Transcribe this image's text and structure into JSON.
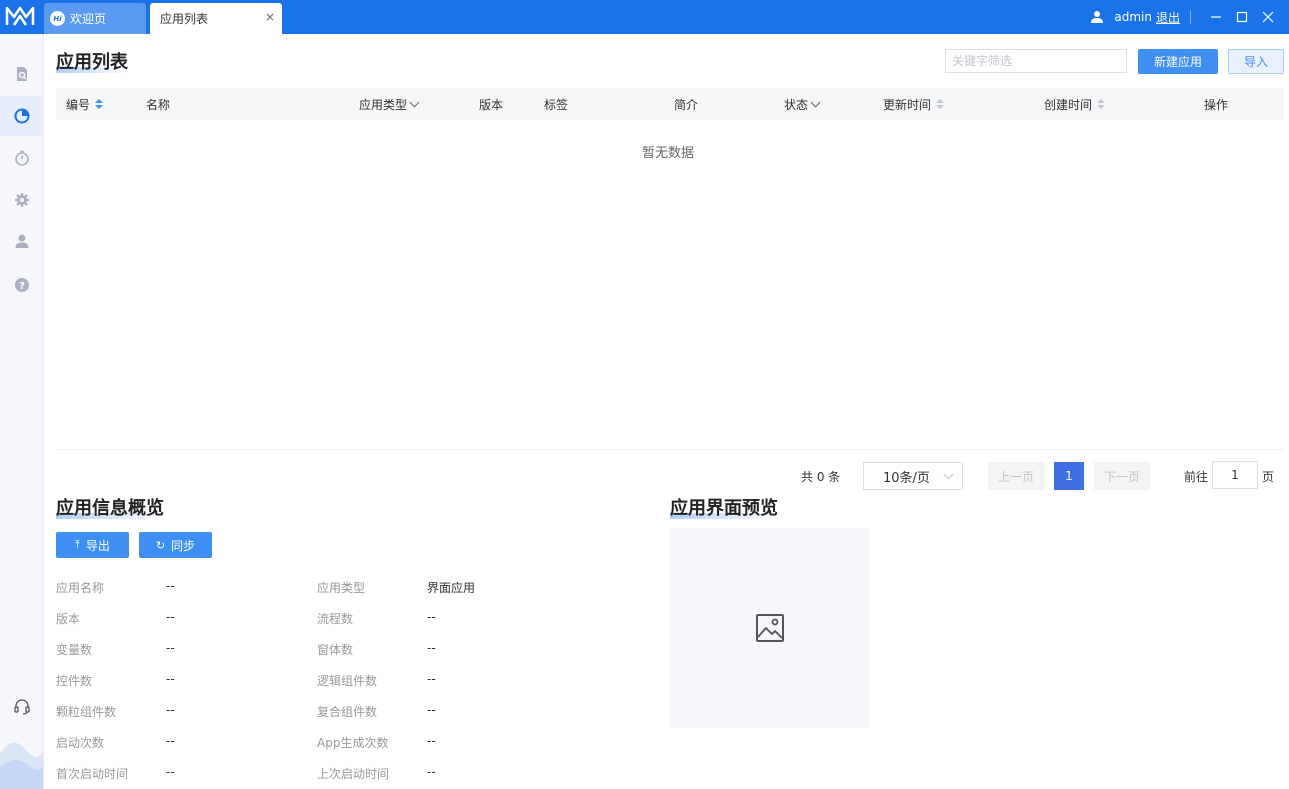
{
  "tabs": [
    {
      "label": "欢迎页",
      "badge": "Hi"
    },
    {
      "label": "应用列表",
      "close": "×"
    }
  ],
  "user": {
    "name": "admin",
    "logout": "退出"
  },
  "colors": {
    "accent": "#1a73e8",
    "primary_button": "#3f8ff3"
  },
  "sidebar": {
    "icons": [
      "search-doc-icon",
      "pie-chart-icon",
      "timer-icon",
      "gear-icon",
      "user-icon",
      "help-icon",
      "headset-icon"
    ],
    "active_index": 1
  },
  "app_list": {
    "title": "应用列表",
    "search_placeholder": "关键字筛选",
    "new_button": "新建应用",
    "import_button": "导入",
    "columns": [
      "编号",
      "名称",
      "应用类型",
      "版本",
      "标签",
      "简介",
      "状态",
      "更新时间",
      "创建时间",
      "操作"
    ],
    "empty_text": "暂无数据"
  },
  "pagination": {
    "total": "共 0 条",
    "page_size": "10条/页",
    "prev": "上一页",
    "current": "1",
    "next": "下一页",
    "goto_label": "前往",
    "goto_value": "1",
    "goto_unit": "页"
  },
  "overview": {
    "title": "应用信息概览",
    "export_button": "导出",
    "sync_button": "同步",
    "fields_left": [
      {
        "label": "应用名称",
        "value": "--"
      },
      {
        "label": "版本",
        "value": "--"
      },
      {
        "label": "变量数",
        "value": "--"
      },
      {
        "label": "控件数",
        "value": "--"
      },
      {
        "label": "颗粒组件数",
        "value": "--"
      },
      {
        "label": "启动次数",
        "value": "--"
      },
      {
        "label": "首次启动时间",
        "value": "--"
      }
    ],
    "fields_right": [
      {
        "label": "应用类型",
        "value": "界面应用"
      },
      {
        "label": "流程数",
        "value": "--"
      },
      {
        "label": "窗体数",
        "value": "--"
      },
      {
        "label": "逻辑组件数",
        "value": "--"
      },
      {
        "label": "复合组件数",
        "value": "--"
      },
      {
        "label": "App生成次数",
        "value": "--"
      },
      {
        "label": "上次启动时间",
        "value": "--"
      }
    ]
  },
  "preview": {
    "title": "应用界面预览",
    "icon": "image-placeholder-icon"
  }
}
